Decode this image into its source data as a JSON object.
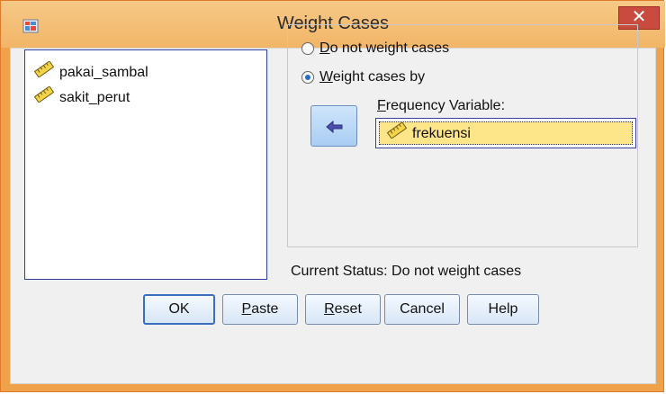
{
  "window": {
    "title": "Weight Cases",
    "close_glyph": "✕"
  },
  "variables": [
    {
      "name": "pakai_sambal",
      "icon": "ruler-icon"
    },
    {
      "name": "sakit_perut",
      "icon": "ruler-icon"
    }
  ],
  "options": {
    "do_not_weight": {
      "first": "D",
      "rest": "o not weight cases",
      "selected": false
    },
    "weight_by": {
      "first": "W",
      "rest": "eight cases by",
      "selected": true
    }
  },
  "frequency": {
    "label_first": "F",
    "label_rest": "requency Variable:",
    "value": "frekuensi"
  },
  "status": "Current Status: Do not weight cases",
  "buttons": {
    "ok": "OK",
    "paste": {
      "first": "P",
      "rest": "aste"
    },
    "reset": {
      "first": "R",
      "rest": "eset"
    },
    "cancel": "Cancel",
    "help": "Help"
  },
  "colors": {
    "accent": "#1f6fd1",
    "field_highlight": "#fde68a",
    "title_bar": "#f2b567"
  }
}
